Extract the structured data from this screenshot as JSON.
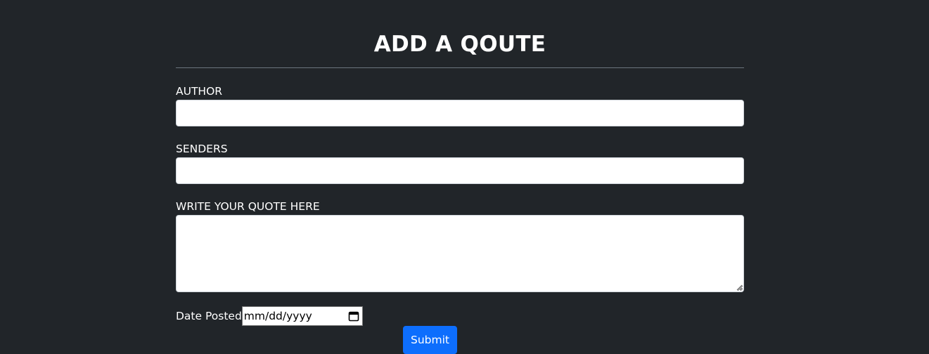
{
  "form": {
    "title": "ADD A QOUTE",
    "author_label": "AUTHOR",
    "author_value": "",
    "senders_label": "SENDERS",
    "senders_value": "",
    "quote_label": "WRITE YOUR QUOTE HERE",
    "quote_value": "",
    "date_label": "Date Posted",
    "date_placeholder": "mm/dd/yyyy",
    "submit_label": "Submit"
  },
  "colors": {
    "background": "#212529",
    "primary": "#0d6efd",
    "text": "#ffffff"
  },
  "icons": {
    "date_picker": "calendar-icon",
    "textarea_resize": "resize-grip-icon"
  }
}
